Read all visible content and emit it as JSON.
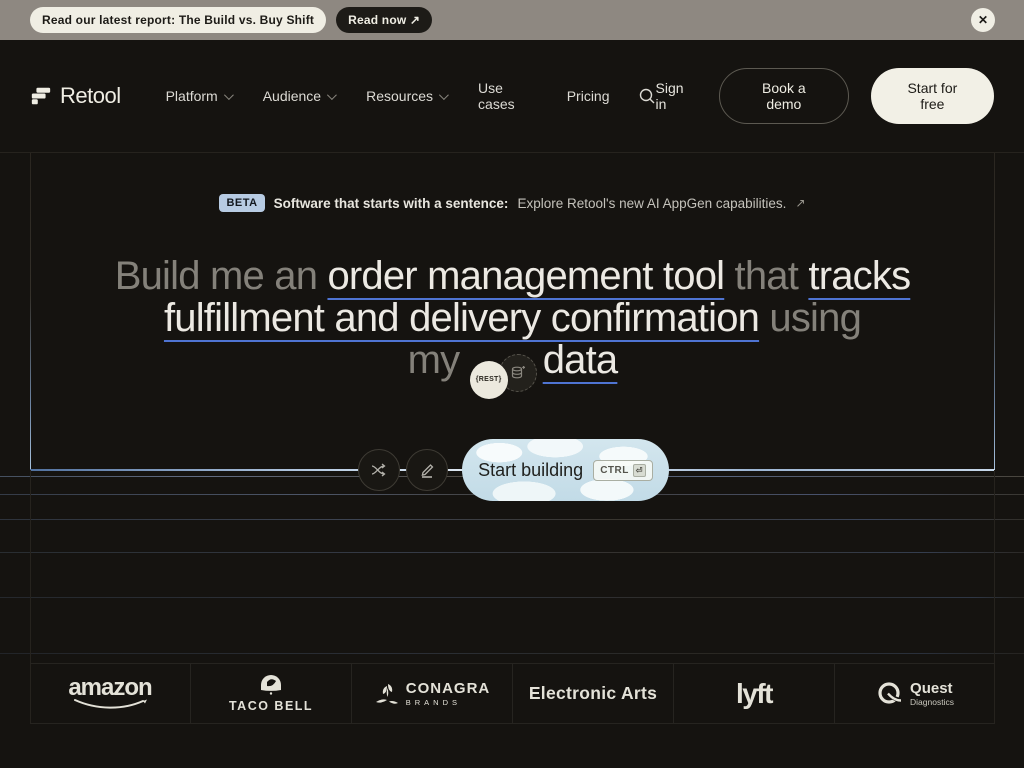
{
  "banner": {
    "message": "Read our latest report: The Build vs. Buy Shift",
    "cta": "Read now ↗",
    "close": "✕"
  },
  "nav": {
    "brand": "Retool",
    "items": [
      {
        "label": "Platform"
      },
      {
        "label": "Audience"
      },
      {
        "label": "Resources"
      },
      {
        "label": "Use cases"
      },
      {
        "label": "Pricing"
      }
    ],
    "sign_in": "Sign in",
    "book_demo": "Book a demo",
    "start_free": "Start for free"
  },
  "hero": {
    "beta_badge": "BETA",
    "announce": "Software that starts with a sentence:",
    "announce_link": "Explore Retool's new AI AppGen capabilities.",
    "announce_arrow": "↗",
    "h1": {
      "l1a": "Build me an ",
      "l1b": "order management tool",
      "l1c": " that ",
      "l1d": "tracks",
      "l2a": "fulfillment and delivery confirmation",
      "l2b": " using",
      "l3a": "my ",
      "l3b": "data"
    },
    "rest_chip": "{REST}",
    "start_building": "Start building",
    "kbd_label": "CTRL",
    "kbd_key": "⏎"
  },
  "logos": {
    "amazon": "amazon",
    "taco_bell": "TACO BELL",
    "conagra": "CONAGRA",
    "conagra_sub": "BRANDS",
    "ea": "Electronic Arts",
    "lyft": "lyft",
    "quest": "Quest",
    "quest_sub": "Diagnostics"
  },
  "colors": {
    "banner_bg": "#8e8881",
    "page_bg": "#151310",
    "cream": "#f0eee4",
    "underline_blue": "#4f74d2",
    "beta_badge_bg": "#b7cbe3",
    "cloud_button": "#cfe2ec"
  }
}
